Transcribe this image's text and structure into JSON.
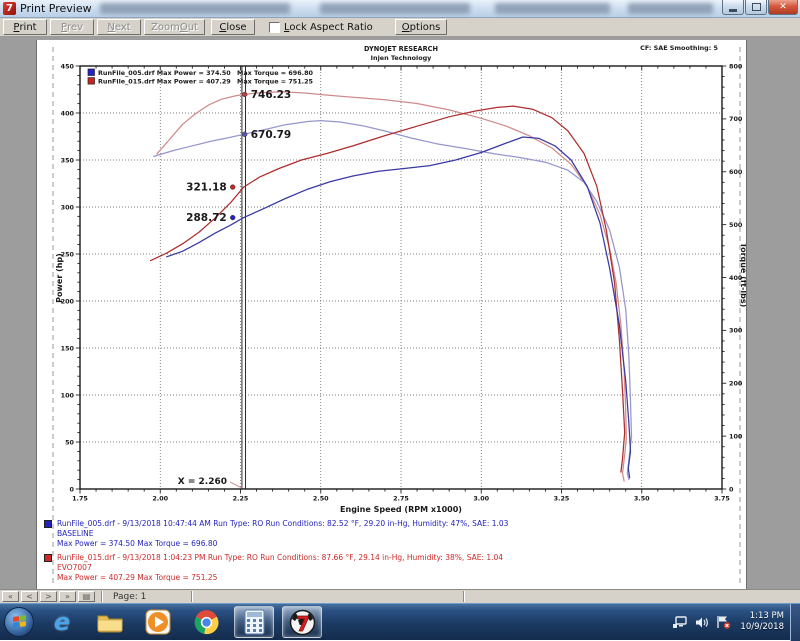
{
  "window": {
    "title": "Print Preview"
  },
  "toolbar": {
    "buttons": [
      {
        "label": "Print",
        "enabled": true
      },
      {
        "label": "Prev",
        "enabled": false
      },
      {
        "label": "Next",
        "enabled": false
      },
      {
        "label": "Zoom Out",
        "enabled": false
      },
      {
        "label": "Close",
        "enabled": true
      }
    ],
    "checkbox_label": "Lock Aspect Ratio",
    "options_label": "Options"
  },
  "statusbar": {
    "nav": [
      "«",
      "<",
      ">",
      "»"
    ],
    "page_icon": "▤",
    "page_label": "Page: 1"
  },
  "taskbar": {
    "icons": [
      "start",
      "internet-explorer",
      "windows-explorer",
      "media-player",
      "chrome",
      "calculator",
      "dynojet"
    ],
    "time": "1:13 PM",
    "date": "10/9/2018"
  },
  "footer_runs": [
    {
      "color": "#2323bb",
      "line1": "RunFile_005.drf - 9/13/2018 10:47:44 AM  Run Type: RO  Run Conditions: 82.52 °F, 29.20 in-Hg,  Humidity:  47%, SAE: 1.03",
      "line2": "BASELINE",
      "line3": "Max Power = 374.50  Max Torque = 696.80"
    },
    {
      "color": "#cc2a2a",
      "line1": "RunFile_015.drf - 9/13/2018 1:04:23 PM  Run Type: RO  Run Conditions: 87.66 °F, 29.14 in-Hg,  Humidity:  38%, SAE: 1.04",
      "line2": "EVO7007",
      "line3": "Max Power = 407.29  Max Torque = 751.25"
    }
  ],
  "chart_data": {
    "type": "line",
    "title": "DYNOJET RESEARCH",
    "subtitle": "Injen Technology",
    "corner_note": "CF: SAE  Smoothing: 5",
    "xlabel": "Engine Speed (RPM x1000)",
    "ylabel_left": "Power (hp)",
    "ylabel_right": "Torque (ft-lbs)",
    "xlim": [
      1.75,
      3.75
    ],
    "ylim_left": [
      0,
      450
    ],
    "ylim_right": [
      0,
      800
    ],
    "x_ticks": [
      1.75,
      2.0,
      2.25,
      2.5,
      2.75,
      3.0,
      3.25,
      3.5,
      3.75
    ],
    "left_ticks": [
      0,
      50,
      100,
      150,
      200,
      250,
      300,
      350,
      400,
      450
    ],
    "right_ticks": [
      0,
      100,
      200,
      300,
      400,
      500,
      600,
      700,
      800
    ],
    "grid": true,
    "legend_position": "top-left",
    "legend": [
      {
        "color": "#2222cc",
        "file": "RunFile_005.drf",
        "power": "Max Power = 374.50",
        "torque": "Max Torque = 696.80"
      },
      {
        "color": "#cc2222",
        "file": "RunFile_015.drf",
        "power": "Max Power = 407.29",
        "torque": "Max Torque = 751.25"
      }
    ],
    "cursor": {
      "x": 2.26,
      "label": "X = 2.260"
    },
    "markers": [
      {
        "label": "746.23",
        "value": 746.23,
        "axis": "right",
        "color": "#c23b3b",
        "side": "right"
      },
      {
        "label": "670.79",
        "value": 670.79,
        "axis": "right",
        "color": "#5555bb",
        "side": "right"
      },
      {
        "label": "321.18",
        "value": 321.18,
        "axis": "left",
        "color": "#cc2222",
        "side": "left"
      },
      {
        "label": "288.72",
        "value": 288.72,
        "axis": "left",
        "color": "#2222cc",
        "side": "left"
      }
    ],
    "series": [
      {
        "name": "runfile-015-torque",
        "axis": "right",
        "color": "#cf8a8a",
        "points": [
          [
            1.99,
            634
          ],
          [
            2.03,
            662
          ],
          [
            2.07,
            690
          ],
          [
            2.11,
            710
          ],
          [
            2.15,
            726
          ],
          [
            2.19,
            737
          ],
          [
            2.23,
            743
          ],
          [
            2.26,
            746.2
          ],
          [
            2.31,
            749.5
          ],
          [
            2.38,
            751.2
          ],
          [
            2.45,
            749
          ],
          [
            2.52,
            745
          ],
          [
            2.6,
            741
          ],
          [
            2.7,
            736
          ],
          [
            2.8,
            729
          ],
          [
            2.9,
            717
          ],
          [
            3.0,
            701
          ],
          [
            3.08,
            686
          ],
          [
            3.15,
            668
          ],
          [
            3.22,
            645
          ],
          [
            3.28,
            614
          ],
          [
            3.33,
            572
          ],
          [
            3.37,
            519
          ],
          [
            3.4,
            455
          ],
          [
            3.42,
            390
          ],
          [
            3.435,
            310
          ],
          [
            3.445,
            225
          ],
          [
            3.45,
            150
          ],
          [
            3.452,
            95
          ],
          [
            3.445,
            55
          ],
          [
            3.44,
            30
          ],
          [
            3.445,
            15
          ]
        ]
      },
      {
        "name": "runfile-005-torque",
        "axis": "right",
        "color": "#9595cd",
        "points": [
          [
            1.98,
            629
          ],
          [
            2.04,
            640
          ],
          [
            2.1,
            649
          ],
          [
            2.16,
            658
          ],
          [
            2.21,
            664
          ],
          [
            2.26,
            670.8
          ],
          [
            2.32,
            679
          ],
          [
            2.39,
            689
          ],
          [
            2.46,
            695
          ],
          [
            2.5,
            696.8
          ],
          [
            2.56,
            694
          ],
          [
            2.63,
            687
          ],
          [
            2.7,
            677
          ],
          [
            2.78,
            664
          ],
          [
            2.86,
            653
          ],
          [
            2.95,
            644
          ],
          [
            3.04,
            634
          ],
          [
            3.12,
            627
          ],
          [
            3.2,
            618
          ],
          [
            3.27,
            603
          ],
          [
            3.32,
            580
          ],
          [
            3.36,
            544
          ],
          [
            3.4,
            490
          ],
          [
            3.43,
            420
          ],
          [
            3.45,
            340
          ],
          [
            3.46,
            250
          ],
          [
            3.465,
            165
          ],
          [
            3.468,
            100
          ],
          [
            3.46,
            55
          ],
          [
            3.455,
            30
          ],
          [
            3.46,
            18
          ]
        ]
      },
      {
        "name": "runfile-015-power",
        "axis": "left",
        "color": "#ad2d2d",
        "points": [
          [
            1.97,
            243
          ],
          [
            2.02,
            251
          ],
          [
            2.07,
            261
          ],
          [
            2.12,
            273
          ],
          [
            2.17,
            288
          ],
          [
            2.22,
            305
          ],
          [
            2.26,
            321.2
          ],
          [
            2.31,
            332
          ],
          [
            2.37,
            341
          ],
          [
            2.44,
            350
          ],
          [
            2.52,
            357
          ],
          [
            2.6,
            365
          ],
          [
            2.7,
            376
          ],
          [
            2.8,
            386
          ],
          [
            2.9,
            396
          ],
          [
            2.98,
            402
          ],
          [
            3.05,
            406
          ],
          [
            3.1,
            407.3
          ],
          [
            3.16,
            404
          ],
          [
            3.22,
            395
          ],
          [
            3.27,
            381
          ],
          [
            3.32,
            357
          ],
          [
            3.36,
            322
          ],
          [
            3.39,
            275
          ],
          [
            3.415,
            220
          ],
          [
            3.43,
            160
          ],
          [
            3.44,
            105
          ],
          [
            3.447,
            60
          ],
          [
            3.44,
            32
          ],
          [
            3.435,
            18
          ]
        ]
      },
      {
        "name": "runfile-005-power",
        "axis": "left",
        "color": "#3939a4",
        "points": [
          [
            2.02,
            247
          ],
          [
            2.07,
            253
          ],
          [
            2.12,
            262
          ],
          [
            2.17,
            272
          ],
          [
            2.22,
            281
          ],
          [
            2.26,
            288.7
          ],
          [
            2.32,
            298
          ],
          [
            2.39,
            309
          ],
          [
            2.46,
            319
          ],
          [
            2.53,
            327
          ],
          [
            2.6,
            333
          ],
          [
            2.68,
            338
          ],
          [
            2.76,
            341
          ],
          [
            2.84,
            344
          ],
          [
            2.92,
            350
          ],
          [
            3.0,
            358
          ],
          [
            3.07,
            367
          ],
          [
            3.13,
            374.5
          ],
          [
            3.18,
            373
          ],
          [
            3.23,
            365
          ],
          [
            3.28,
            350
          ],
          [
            3.33,
            322
          ],
          [
            3.37,
            283
          ],
          [
            3.4,
            235
          ],
          [
            3.43,
            175
          ],
          [
            3.45,
            115
          ],
          [
            3.46,
            70
          ],
          [
            3.465,
            40
          ],
          [
            3.458,
            22
          ],
          [
            3.462,
            12
          ]
        ]
      }
    ]
  }
}
